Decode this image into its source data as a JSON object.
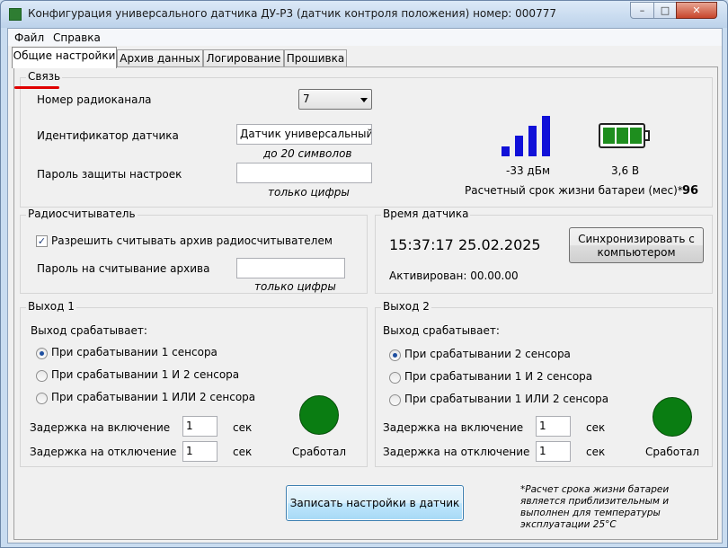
{
  "window": {
    "title": "Конфигурация универсального датчика ДУ-Р3 (датчик контроля положения) номер: 000777",
    "min_label": "–",
    "max_label": "□",
    "close_label": "✕"
  },
  "menu": {
    "file": "Файл",
    "help": "Справка"
  },
  "tabs": [
    {
      "label": "Общие настройки"
    },
    {
      "label": "Архив данных"
    },
    {
      "label": "Логирование"
    },
    {
      "label": "Прошивка"
    }
  ],
  "connection": {
    "title": "Связь",
    "channel_label": "Номер радиоканала",
    "channel_value": "7",
    "id_label": "Идентификатор датчика",
    "id_value": "Датчик универсальный",
    "id_hint": "до 20 символов",
    "pwd_label": "Пароль защиты настроек",
    "pwd_value": "",
    "pwd_hint": "только цифры",
    "signal_text": "-33 дБм",
    "signal_level": 4,
    "signal_max": 4,
    "battery_text": "3,6 В",
    "battery_cells": 3,
    "battery_life_label": "Расчетный срок жизни батареи (мес)*:",
    "battery_life_value": "96"
  },
  "reader": {
    "title": "Радиосчитыватель",
    "allow_label": "Разрешить считывать архив радиосчитывателем",
    "allow_checked": true,
    "pwd_label": "Пароль на считывание архива",
    "pwd_value": "",
    "pwd_hint": "только цифры"
  },
  "sensor_time": {
    "title": "Время датчика",
    "time": "15:37:17",
    "date": "25.02.2025",
    "sync_button": "Синхронизировать с компьютером",
    "activated": "Активирован: 00.00.00"
  },
  "out1": {
    "title": "Выход 1",
    "trigger_label": "Выход срабатывает:",
    "options": [
      "При срабатывании 1 сенсора",
      "При срабатывании 1 И 2 сенсора",
      "При срабатывании 1 ИЛИ 2 сенсора"
    ],
    "selected": 0,
    "delay_on_label": "Задержка на включение",
    "delay_on_value": "1",
    "delay_off_label": "Задержка на отключение",
    "delay_off_value": "1",
    "unit": "сек",
    "status_label": "Сработал",
    "status_color": "#0a7d12"
  },
  "out2": {
    "title": "Выход 2",
    "trigger_label": "Выход срабатывает:",
    "options": [
      "При срабатывании 2 сенсора",
      "При срабатывании 1 И 2 сенсора",
      "При срабатывании 1 ИЛИ 2 сенсора"
    ],
    "selected": 0,
    "delay_on_label": "Задержка на включение",
    "delay_on_value": "1",
    "delay_off_label": "Задержка на отключение",
    "delay_off_value": "1",
    "unit": "сек",
    "status_label": "Сработал",
    "status_color": "#0a7d12"
  },
  "footer": {
    "write_button": "Записать настройки в датчик",
    "footnote": "*Расчет срока жизни батареи является приблизительным и выполнен для температуры эксплуатации 25°С"
  }
}
